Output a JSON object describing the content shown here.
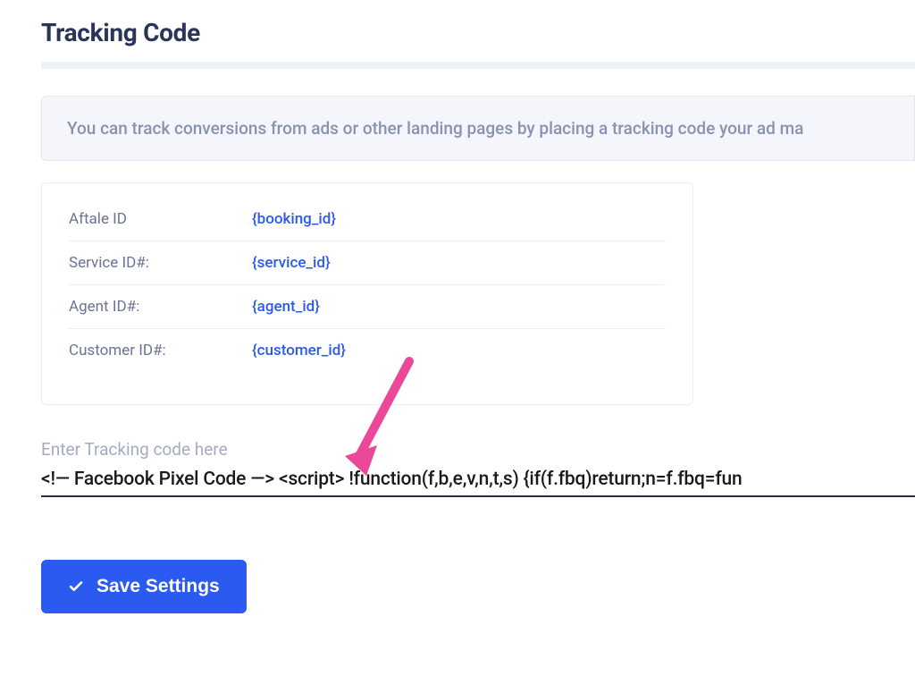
{
  "page": {
    "title": "Tracking Code"
  },
  "banner": {
    "text": "You can track conversions from ads or other landing pages by placing a tracking code your ad ma"
  },
  "variables": {
    "rows": [
      {
        "label": "Aftale ID",
        "value": "{booking_id}"
      },
      {
        "label": "Service ID#:",
        "value": "{service_id}"
      },
      {
        "label": "Agent ID#:",
        "value": "{agent_id}"
      },
      {
        "label": "Customer ID#:",
        "value": "{customer_id}"
      }
    ]
  },
  "tracking_input": {
    "label": "Enter Tracking code here",
    "value": "<!— Facebook Pixel Code —> <script> !function(f,b,e,v,n,t,s) {if(f.fbq)return;n=f.fbq=fun"
  },
  "actions": {
    "save_label": "Save Settings"
  }
}
